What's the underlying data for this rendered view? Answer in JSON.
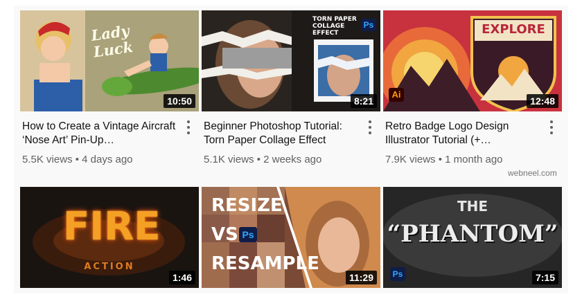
{
  "videos": [
    {
      "title": "How to Create a Vintage Aircraft ‘Nose Art’ Pin-Up…",
      "meta": "5.5K views • 4 days ago",
      "duration": "10:50",
      "thumb_text": "Lady Luck"
    },
    {
      "title": "Beginner Photoshop Tutorial: Torn Paper Collage Effect",
      "meta": "5.1K views • 2 weeks ago",
      "duration": "8:21",
      "thumb_text": "TORN PAPER COLLAGE EFFECT",
      "badge": "Ps"
    },
    {
      "title": "Retro Badge Logo Design Illustrator Tutorial (+…",
      "meta": "7.9K views • 1 month ago",
      "duration": "12:48",
      "thumb_text": "EXPLORE",
      "badge": "Ai"
    },
    {
      "duration": "1:46",
      "thumb_text": "FIRE",
      "thumb_subtext": "ACTION"
    },
    {
      "duration": "11:29",
      "thumb_text": "RESIZE",
      "thumb_text_2": "VS",
      "thumb_text_3": "RESAMPLE",
      "badge": "Ps"
    },
    {
      "duration": "7:15",
      "thumb_text": "THE",
      "thumb_text_2": "“PHANTOM”",
      "badge": "Ps"
    }
  ],
  "watermark": "webneel.com",
  "colors": {
    "panel": "#f9f9f9",
    "title": "#111111",
    "meta": "#606060",
    "duration_bg": "#000000"
  }
}
